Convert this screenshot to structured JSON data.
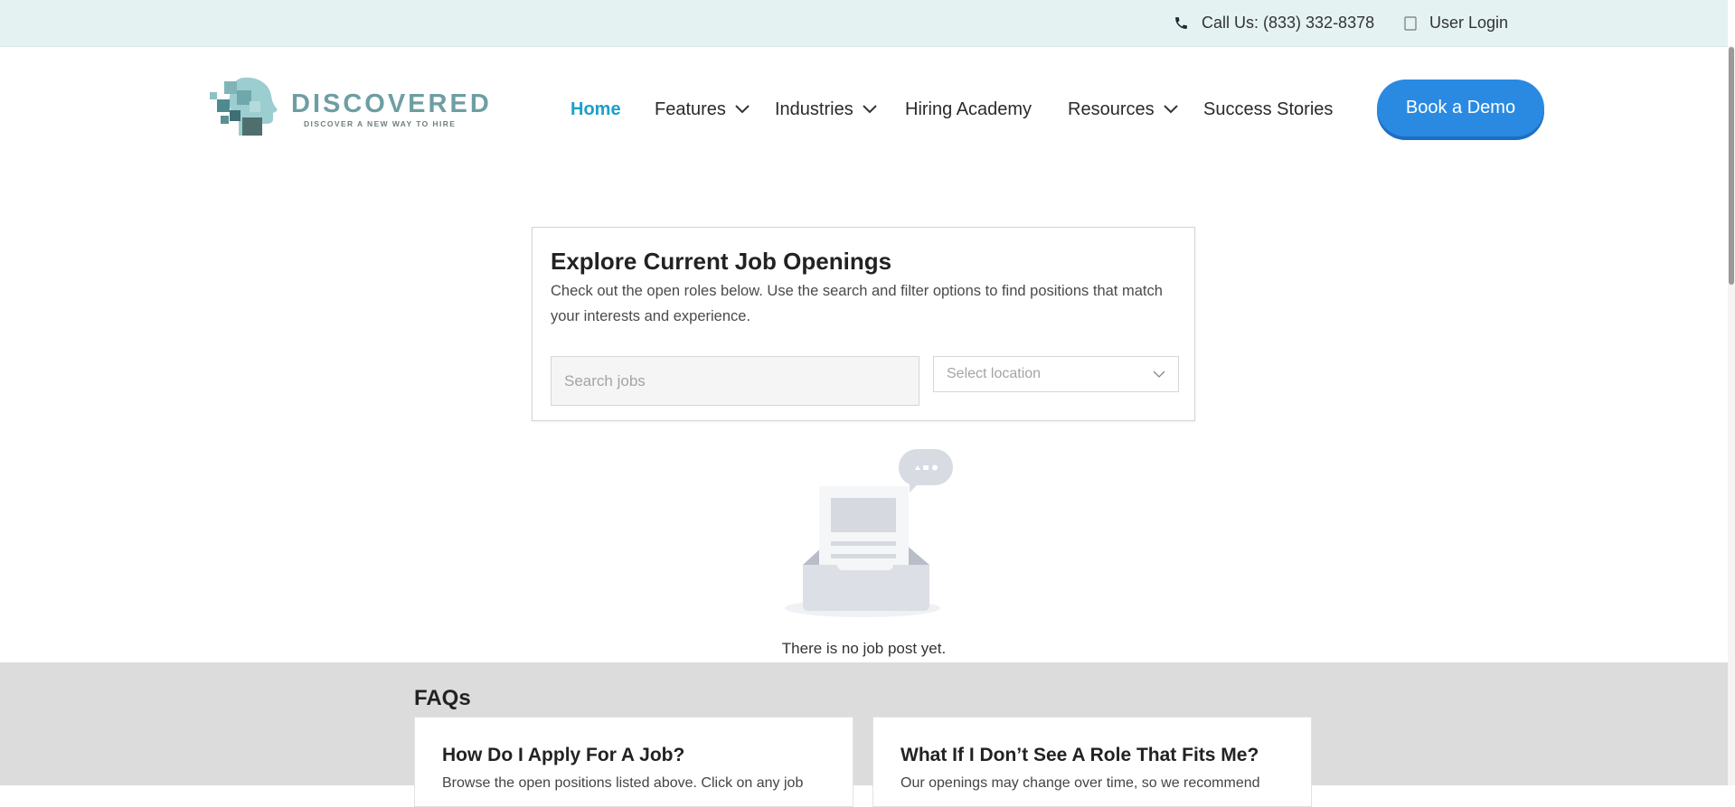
{
  "topbar": {
    "phone_label": "Call Us: (833) 332-8378",
    "phone_icon": "phone-icon",
    "login_label": "User Login",
    "login_icon": "user-icon"
  },
  "brand": {
    "name": "DISCOVERED",
    "tagline": "DISCOVER A NEW WAY TO HIRE"
  },
  "nav": {
    "items": [
      {
        "label": "Home",
        "active": true
      },
      {
        "label": "Features",
        "has_dropdown": true
      },
      {
        "label": "Industries",
        "has_dropdown": true
      },
      {
        "label": "Hiring Academy"
      },
      {
        "label": "Resources",
        "has_dropdown": true
      },
      {
        "label": "Success Stories"
      }
    ],
    "cta_label": "Book a Demo"
  },
  "jobs": {
    "title": "Explore Current Job Openings",
    "description": "Check out the open roles below. Use the search and filter options to find positions that match your interests and experience.",
    "search_placeholder": "Search jobs",
    "search_value": "",
    "location_placeholder": "Select location",
    "empty_message": "There is no job post yet."
  },
  "faq": {
    "title": "FAQs",
    "items": [
      {
        "question": "How Do I Apply For A Job?",
        "answer": "Browse the open positions listed above. Click on any job"
      },
      {
        "question": "What If I Don’t See A Role That Fits Me?",
        "answer": "Our openings may change over time, so we recommend"
      }
    ]
  },
  "colors": {
    "topbar_bg": "#e4f2f2",
    "accent": "#1aa0c8",
    "cta": "#2a8ae2",
    "faq_bg": "#dcdcdc",
    "brand_teal": "#6d9ea2"
  }
}
